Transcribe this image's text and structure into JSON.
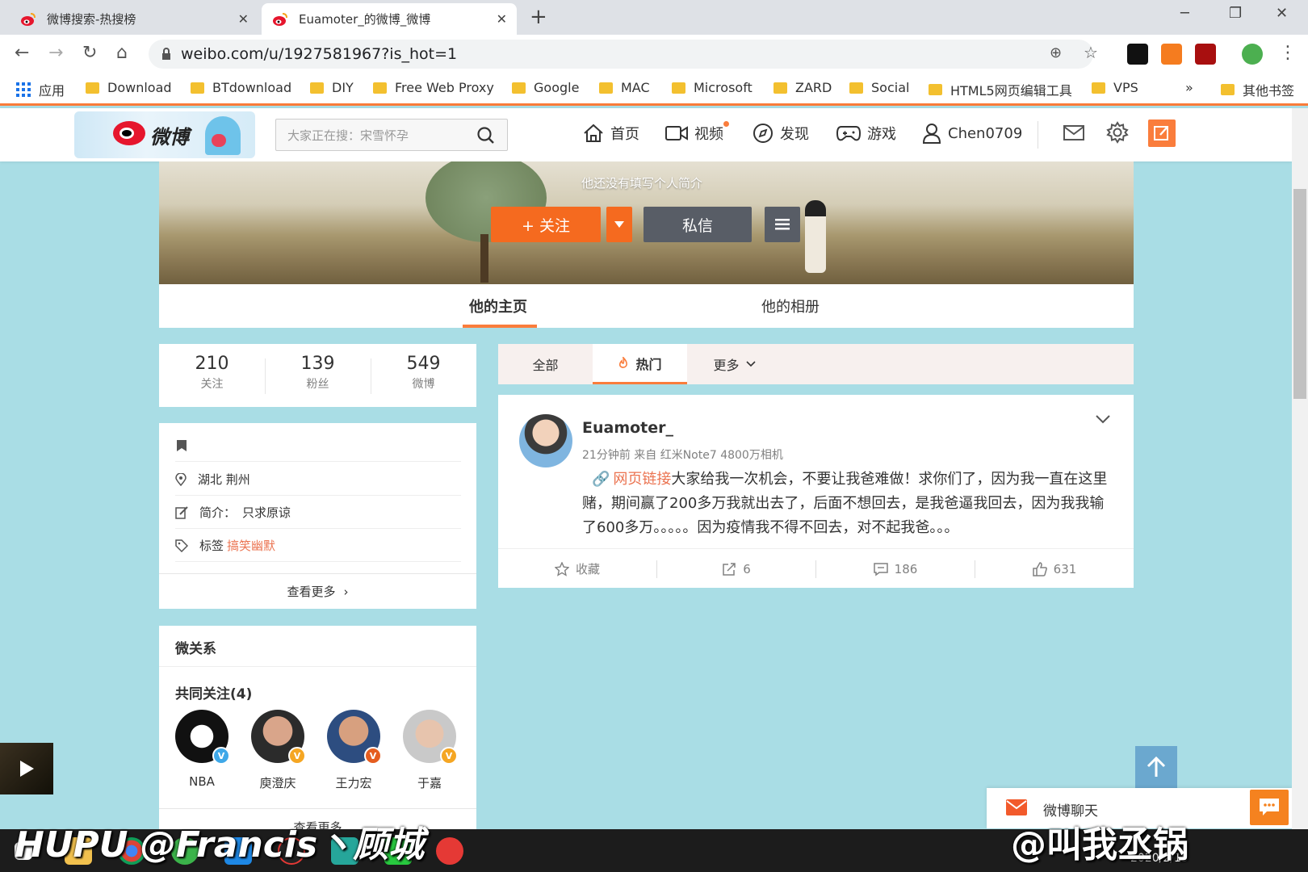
{
  "browser": {
    "tabs": [
      {
        "title": "微博搜索-热搜榜",
        "active": false
      },
      {
        "title": "Euamoter_的微博_微博",
        "active": true
      }
    ],
    "url": "weibo.com/u/1927581967?is_hot=1",
    "bookmarks": [
      "应用",
      "Download",
      "BTdownload",
      "DIY",
      "Free Web Proxy",
      "Google",
      "MAC",
      "Microsoft",
      "ZARD",
      "Social",
      "HTML5网页编辑工具",
      "VPS"
    ],
    "bookmarks_overflow": "»",
    "other_bookmarks": "其他书签"
  },
  "weibo_nav": {
    "logo_text": "微博",
    "search_placeholder": "大家正在搜：宋雪怀孕",
    "items": [
      "首页",
      "视频",
      "发现",
      "游戏",
      "Chen0709"
    ]
  },
  "profile": {
    "bio": "他还没有填写个人简介",
    "follow_label": "+ 关注",
    "message_label": "私信",
    "tabs": [
      "他的主页",
      "他的相册"
    ],
    "stats": [
      {
        "value": "210",
        "label": "关注"
      },
      {
        "value": "139",
        "label": "粉丝"
      },
      {
        "value": "549",
        "label": "微博"
      }
    ],
    "location": "湖北 荆州",
    "intro_label": "简介：",
    "intro": "只求原谅",
    "tags_label": "标签",
    "tag": "搞笑幽默",
    "see_more": "查看更多"
  },
  "relations": {
    "title": "微关系",
    "common_title": "共同关注(4)",
    "friends": [
      {
        "name": "NBA",
        "badge_color": "#3fa8e8"
      },
      {
        "name": "庾澄庆",
        "badge_color": "#f5a623"
      },
      {
        "name": "王力宏",
        "badge_color": "#f5a623"
      },
      {
        "name": "于嘉",
        "badge_color": "#f5a623"
      }
    ],
    "see_more": "查看更多"
  },
  "feed": {
    "tabs": [
      "全部",
      "热门",
      "更多"
    ],
    "active_tab": "热门",
    "post": {
      "author": "Euamoter_",
      "meta": "21分钟前 来自 红米Note7 4800万相机",
      "link_text": "网页链接",
      "text": "大家给我一次机会，不要让我爸难做！求你们了，因为我一直在这里赌，期间赢了200多万我就出去了，后面不想回去，是我爸逼我回去，因为我我输了600多万。。。。。因为疫情我不得不回去，对不起我爸。。。",
      "actions": {
        "favorite": "收藏",
        "repost": "6",
        "comment": "186",
        "like": "631"
      }
    }
  },
  "chat": {
    "label": "微博聊天"
  },
  "taskbar": {
    "date": "2020/2/15"
  },
  "watermarks": {
    "left": "HUPU @Francis丶顾城",
    "right": "@叫我丞锅"
  },
  "colors": {
    "accent": "#fa7d3c",
    "page_bg": "#a9dde5",
    "link": "#eb7350"
  }
}
